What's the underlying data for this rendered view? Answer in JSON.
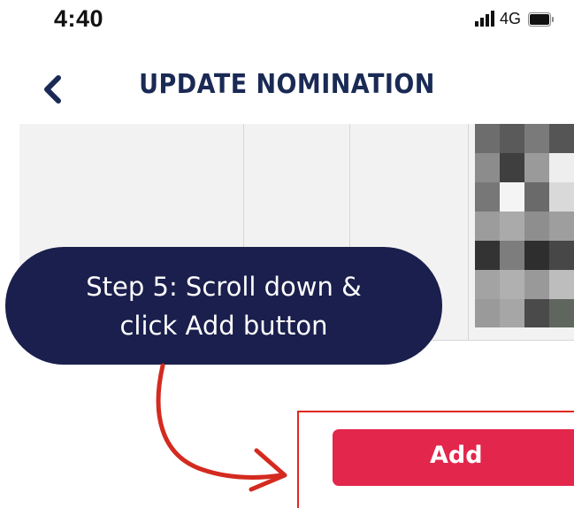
{
  "status_bar": {
    "time": "4:40",
    "network": "4G",
    "icons": [
      "signal-icon",
      "battery-icon"
    ]
  },
  "header": {
    "back_icon": "chevron-left-icon",
    "title": "UPDATE NOMINATION"
  },
  "callout": {
    "line1": "Step 5: Scroll down &",
    "line2": "click Add button"
  },
  "add_button": {
    "label": "Add"
  },
  "colors": {
    "title": "#1a2a55",
    "callout_bg": "#1a1f4d",
    "add_button": "#e3264c",
    "annotation_red": "#e0281f"
  }
}
